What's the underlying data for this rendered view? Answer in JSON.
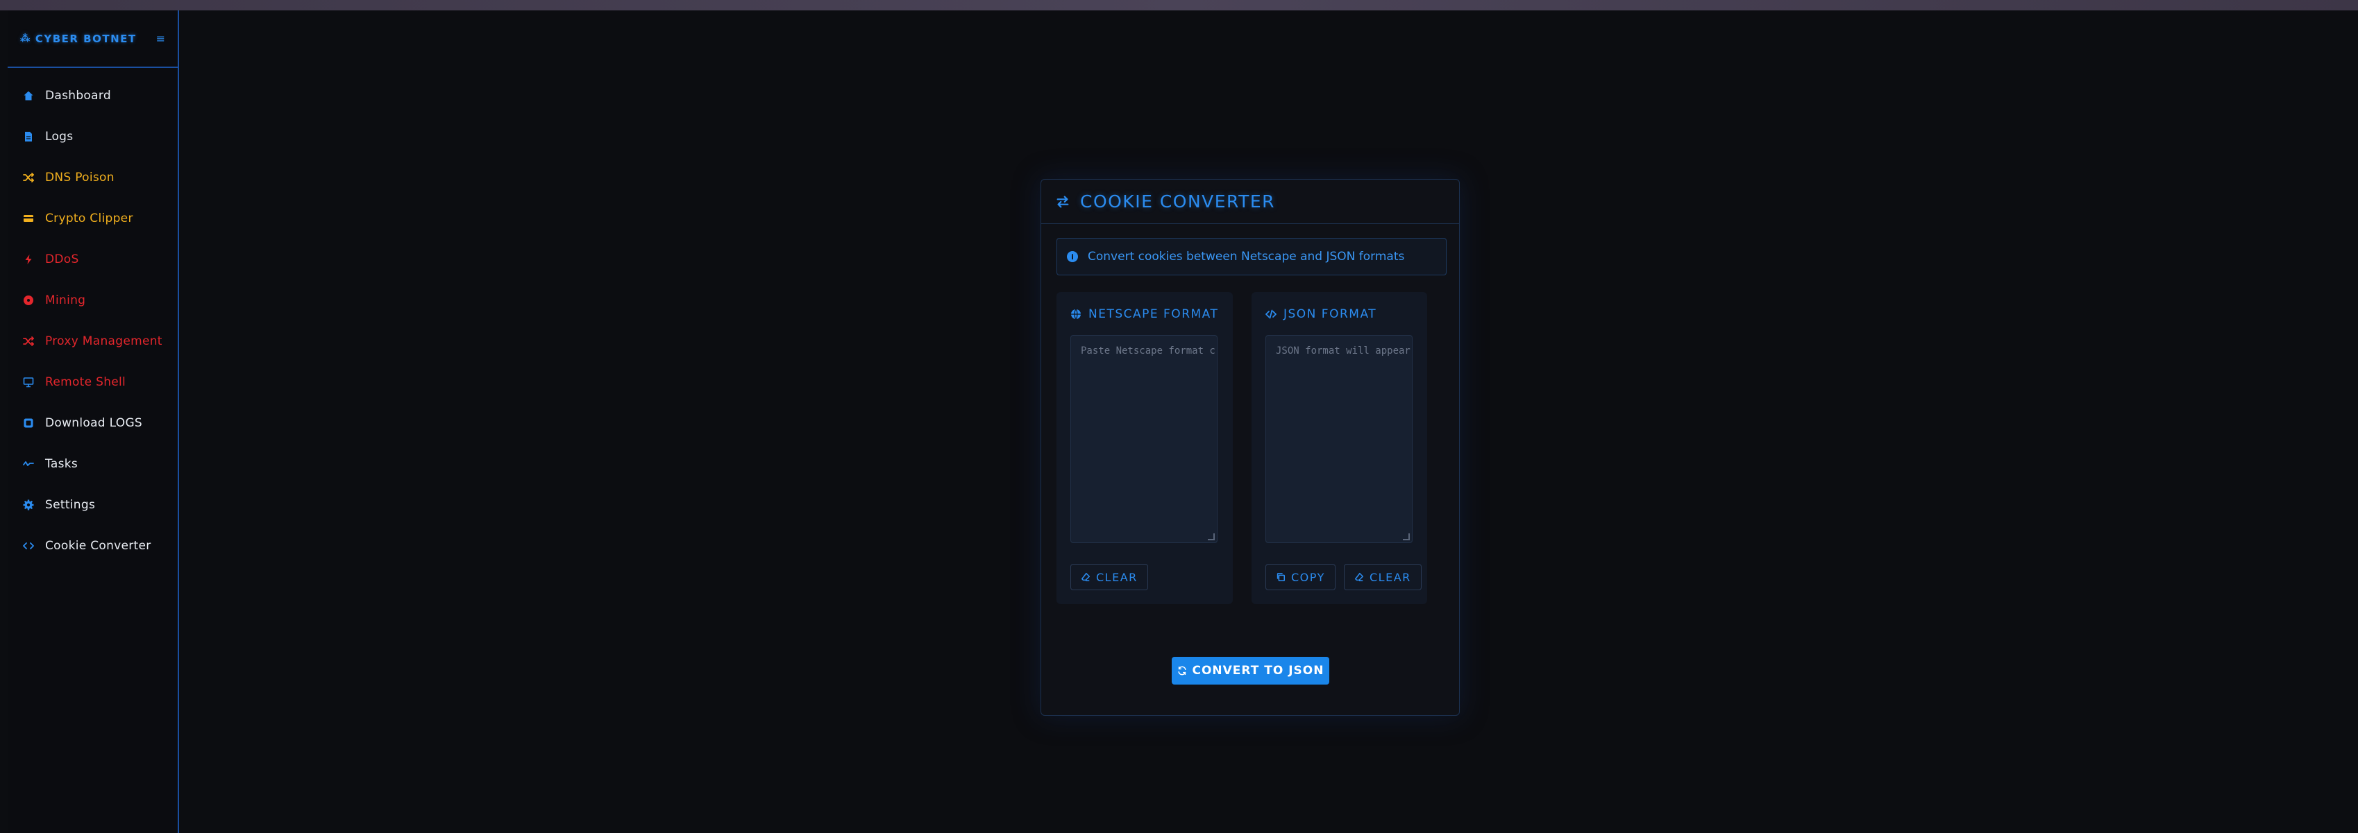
{
  "sidebar": {
    "brand": "CYBER BOTNET",
    "items": [
      {
        "label": "Dashboard",
        "icon": "home-icon",
        "color": "#e8ecf2"
      },
      {
        "label": "Logs",
        "icon": "file-icon",
        "color": "#e8ecf2"
      },
      {
        "label": "DNS Poison",
        "icon": "shuffle-icon",
        "color": "#f2b01e"
      },
      {
        "label": "Crypto Clipper",
        "icon": "card-icon",
        "color": "#f2b01e"
      },
      {
        "label": "DDoS",
        "icon": "bolt-icon",
        "color": "#e3262c"
      },
      {
        "label": "Mining",
        "icon": "disc-icon",
        "color": "#e3262c"
      },
      {
        "label": "Proxy Management",
        "icon": "network-icon",
        "color": "#e3262c"
      },
      {
        "label": "Remote Shell",
        "icon": "monitor-icon",
        "color": "#e3262c"
      },
      {
        "label": "Download LOGS",
        "icon": "download-icon",
        "color": "#e8ecf2"
      },
      {
        "label": "Tasks",
        "icon": "pulse-icon",
        "color": "#e8ecf2"
      },
      {
        "label": "Settings",
        "icon": "gear-icon",
        "color": "#e8ecf2"
      },
      {
        "label": "Cookie Converter",
        "icon": "code-icon",
        "color": "#e8ecf2"
      }
    ]
  },
  "panel": {
    "title": "COOKIE CONVERTER",
    "info": "Convert cookies between Netscape and JSON formats",
    "netscape": {
      "title": "NETSCAPE FORMAT",
      "placeholder": "Paste Netscape format c",
      "clear_label": "CLEAR"
    },
    "json": {
      "title": "JSON FORMAT",
      "placeholder": "JSON format will appear",
      "copy_label": "COPY",
      "clear_label": "CLEAR"
    },
    "convert_label": "CONVERT TO JSON"
  },
  "colors": {
    "accent": "#2b8cf0",
    "warning": "#f2b01e",
    "danger": "#e3262c",
    "default": "#e8ecf2"
  }
}
